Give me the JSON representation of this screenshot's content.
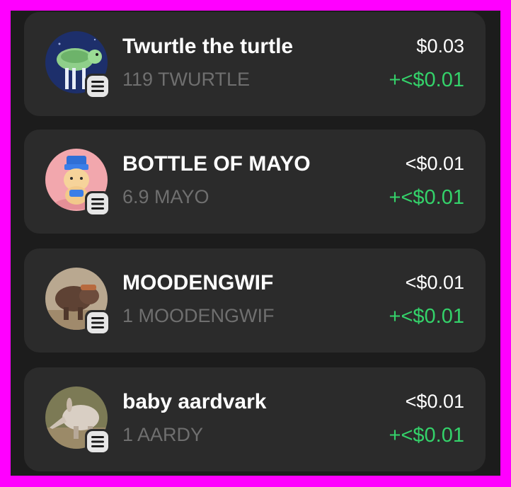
{
  "tokens": [
    {
      "name": "Twurtle the turtle",
      "amount": "119 TWURTLE",
      "value": "$0.03",
      "change": "+<$0.01",
      "icon": "turtle-avatar-icon"
    },
    {
      "name": "BOTTLE OF MAYO",
      "amount": "6.9 MAYO",
      "value": "<$0.01",
      "change": "+<$0.01",
      "icon": "mayo-cat-avatar-icon"
    },
    {
      "name": "MOODENGWIF",
      "amount": "1 MOODENGWIF",
      "value": "<$0.01",
      "change": "+<$0.01",
      "icon": "hippo-avatar-icon"
    },
    {
      "name": "baby aardvark",
      "amount": "1 AARDY",
      "value": "<$0.01",
      "change": "+<$0.01",
      "icon": "aardvark-avatar-icon"
    }
  ],
  "colors": {
    "frame": "#ff00ff",
    "background": "#1c1c1c",
    "card": "#2b2b2b",
    "positive": "#34d26a",
    "muted": "#6f6f6f"
  },
  "chain_badge_icon": "solana-icon"
}
